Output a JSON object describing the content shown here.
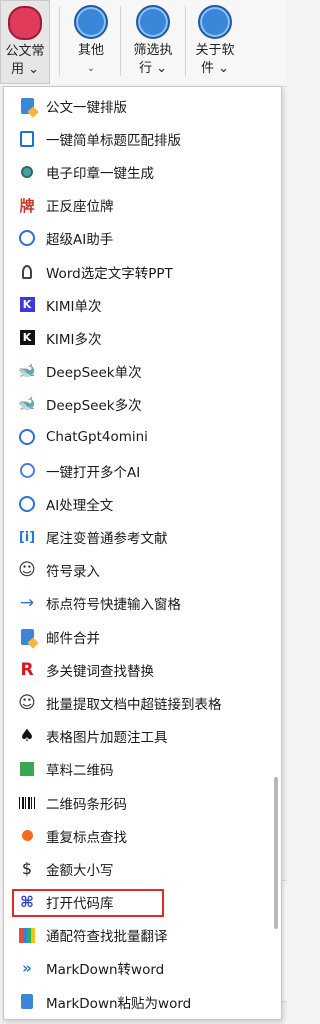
{
  "ribbon": {
    "group1": {
      "label_line1": "公文常",
      "label_line2": "用"
    },
    "group2": {
      "label": "其他"
    },
    "group3": {
      "label_line1": "筛选执",
      "label_line2": "行"
    },
    "group4": {
      "label_line1": "关于软",
      "label_line2": "件"
    },
    "chevron": "⌄"
  },
  "side": {
    "collapse_icon": "chevron-down",
    "close_glyph": "×"
  },
  "menu": {
    "items": [
      {
        "label": "公文一键排版",
        "icon": "doc-icon"
      },
      {
        "label": "一键简单标题匹配排版",
        "icon": "blue-doc-icon"
      },
      {
        "label": "电子印章一键生成",
        "icon": "seal-icon"
      },
      {
        "label": "正反座位牌",
        "icon": "seat-card-icon",
        "glyph": "牌"
      },
      {
        "label": "超级AI助手",
        "icon": "openai-icon"
      },
      {
        "label": "Word选定文字转PPT",
        "icon": "pin-icon"
      },
      {
        "label": "KIMI单次",
        "icon": "kimi-icon",
        "glyph": "K"
      },
      {
        "label": "KIMI多次",
        "icon": "kimi-dark-icon",
        "glyph": "K"
      },
      {
        "label": "DeepSeek单次",
        "icon": "deepseek-icon",
        "glyph": "🐋"
      },
      {
        "label": "DeepSeek多次",
        "icon": "deepseek-multi-icon",
        "glyph": "🐋"
      },
      {
        "label": "ChatGpt4omini",
        "icon": "openai-icon"
      },
      {
        "label": "一键打开多个AI",
        "icon": "globe-icon"
      },
      {
        "label": "AI处理全文",
        "icon": "openai-icon"
      },
      {
        "label": "尾注变普通参考文献",
        "icon": "bracket-icon",
        "glyph": "[i]"
      },
      {
        "label": "符号录入",
        "icon": "smile-icon",
        "glyph": "☺"
      },
      {
        "label": "标点符号快捷输入窗格",
        "icon": "arrow-icon",
        "glyph": "→"
      },
      {
        "label": "邮件合并",
        "icon": "doc-icon"
      },
      {
        "label": "多关键词查找替换",
        "icon": "r-icon",
        "glyph": "R"
      },
      {
        "label": "批量提取文档中超链接到表格",
        "icon": "smile-icon",
        "glyph": "☺"
      },
      {
        "label": "表格图片加题注工具",
        "icon": "spade-icon",
        "glyph": "♠"
      },
      {
        "label": "草料二维码",
        "icon": "qr-icon"
      },
      {
        "label": "二维码条形码",
        "icon": "barcode-icon"
      },
      {
        "label": "重复标点查找",
        "icon": "orange-dot-icon"
      },
      {
        "label": "金额大小写",
        "icon": "dollar-icon",
        "glyph": "$"
      },
      {
        "label": "打开代码库",
        "icon": "code-icon",
        "glyph": "⌘",
        "highlighted": true
      },
      {
        "label": "通配符查找批量翻译",
        "icon": "books-icon"
      },
      {
        "label": "MarkDown转word",
        "icon": "markdown-icon",
        "glyph": "»"
      },
      {
        "label": "MarkDown粘贴为word",
        "icon": "clipboard-icon"
      }
    ]
  }
}
